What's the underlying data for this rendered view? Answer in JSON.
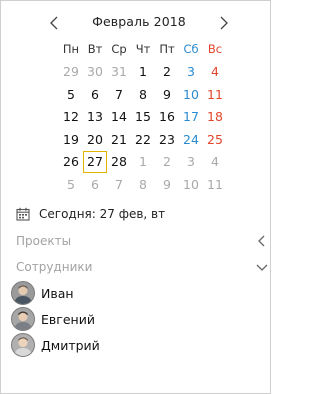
{
  "calendar": {
    "title": "Февраль 2018",
    "weekdays": [
      "Пн",
      "Вт",
      "Ср",
      "Чт",
      "Пт",
      "Сб",
      "Вс"
    ],
    "weeks": [
      [
        {
          "d": "29",
          "o": true
        },
        {
          "d": "30",
          "o": true
        },
        {
          "d": "31",
          "o": true
        },
        {
          "d": "1"
        },
        {
          "d": "2"
        },
        {
          "d": "3"
        },
        {
          "d": "4"
        }
      ],
      [
        {
          "d": "5"
        },
        {
          "d": "6"
        },
        {
          "d": "7"
        },
        {
          "d": "8"
        },
        {
          "d": "9"
        },
        {
          "d": "10"
        },
        {
          "d": "11"
        }
      ],
      [
        {
          "d": "12"
        },
        {
          "d": "13"
        },
        {
          "d": "14"
        },
        {
          "d": "15"
        },
        {
          "d": "16"
        },
        {
          "d": "17"
        },
        {
          "d": "18"
        }
      ],
      [
        {
          "d": "19"
        },
        {
          "d": "20"
        },
        {
          "d": "21"
        },
        {
          "d": "22"
        },
        {
          "d": "23"
        },
        {
          "d": "24"
        },
        {
          "d": "25"
        }
      ],
      [
        {
          "d": "26"
        },
        {
          "d": "27",
          "today": true
        },
        {
          "d": "28"
        },
        {
          "d": "1",
          "o": true
        },
        {
          "d": "2",
          "o": true
        },
        {
          "d": "3",
          "o": true
        },
        {
          "d": "4",
          "o": true
        }
      ],
      [
        {
          "d": "5",
          "o": true
        },
        {
          "d": "6",
          "o": true
        },
        {
          "d": "7",
          "o": true
        },
        {
          "d": "8",
          "o": true
        },
        {
          "d": "9",
          "o": true
        },
        {
          "d": "10",
          "o": true
        },
        {
          "d": "11",
          "o": true
        }
      ]
    ]
  },
  "today": {
    "label": "Сегодня: 27 фев, вт"
  },
  "sections": {
    "projects": {
      "label": "Проекты",
      "icon": "chevron-left-icon"
    },
    "employees": {
      "label": "Сотрудники",
      "icon": "chevron-down-icon"
    }
  },
  "employees": [
    {
      "name": "Иван"
    },
    {
      "name": "Евгений"
    },
    {
      "name": "Дмитрий"
    }
  ],
  "colors": {
    "saturday": "#2b8ccf",
    "sunday": "#e2462d",
    "today_border": "#e2b200",
    "muted": "#a3a3a3"
  }
}
